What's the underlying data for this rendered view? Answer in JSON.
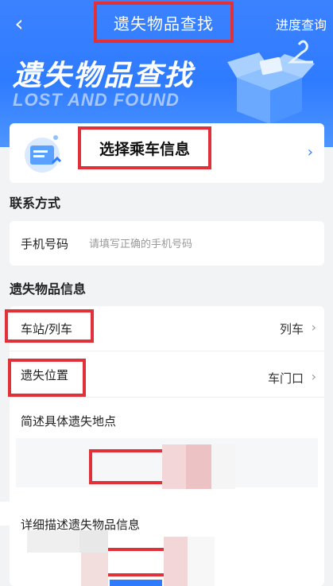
{
  "nav": {
    "back_icon": "chevron-left-icon",
    "title": "遗失物品查找",
    "progress_link": "进度查询"
  },
  "banner": {
    "title": "遗失物品查找",
    "subtitle": "LOST AND FOUND"
  },
  "ride": {
    "label": "选择乘车信息",
    "chevron": "›"
  },
  "contact": {
    "section_title": "联系方式",
    "phone_label": "手机号码",
    "phone_placeholder": "请填写正确的手机号码",
    "phone_value": ""
  },
  "lost": {
    "section_title": "遗失物品信息",
    "station_label": "车站/列车",
    "station_value": "列车",
    "location_label": "遗失位置",
    "location_value": "车门口",
    "brief_title": "简述具体遗失地点",
    "detail_title": "详细描述遗失物品信息",
    "chevron": "›"
  },
  "colors": {
    "header_blue": "#2f7bff",
    "highlight_red": "#e0303a",
    "page_bg": "#f2f3f5"
  }
}
